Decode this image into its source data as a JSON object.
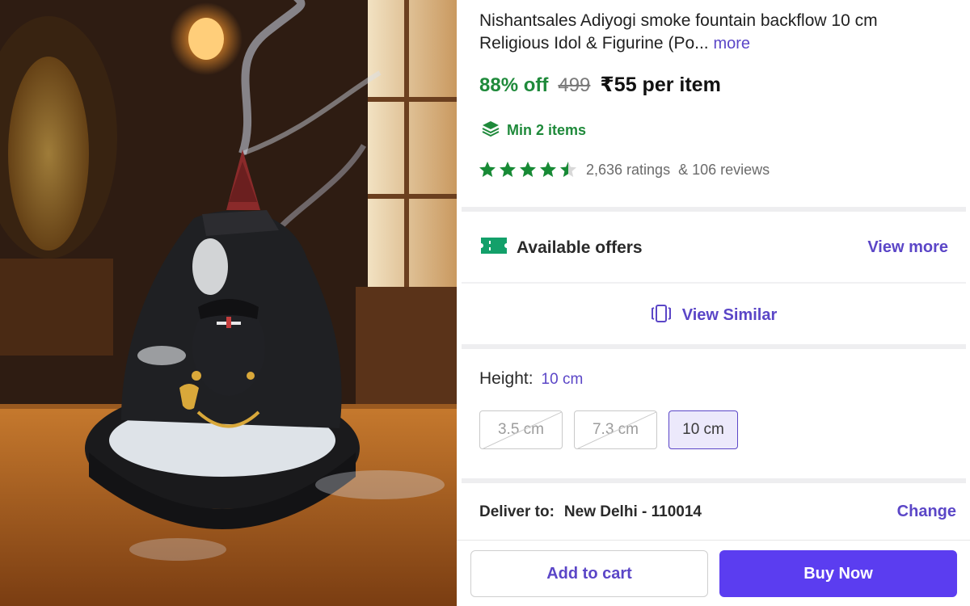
{
  "product": {
    "title": "Nishantsales Adiyogi smoke fountain backflow 10 cm Religious Idol & Figurine (Po...",
    "more_label": "more",
    "discount": "88% off",
    "mrp": "499",
    "price": "₹55 per item",
    "min_items": "Min 2 items",
    "rating": 4.5,
    "ratings_text": "2,636 ratings",
    "reviews_text": "& 106 reviews"
  },
  "offers": {
    "label": "Available offers",
    "link": "View more"
  },
  "similar": {
    "label": "View Similar"
  },
  "height": {
    "label": "Height:",
    "selected": "10 cm",
    "options": [
      "3.5 cm",
      "7.3 cm",
      "10 cm"
    ]
  },
  "delivery": {
    "label": "Deliver to:",
    "location": "New Delhi - 110014",
    "change_label": "Change"
  },
  "actions": {
    "add_to_cart": "Add to cart",
    "buy_now": "Buy Now"
  },
  "colors": {
    "accent": "#5b46c7",
    "buy_button": "#5b3df0",
    "discount_green": "#1f8a3b",
    "star_green": "#178a35"
  },
  "icons": [
    "layers-icon",
    "star-icon",
    "ticket-icon",
    "similar-cards-icon"
  ]
}
